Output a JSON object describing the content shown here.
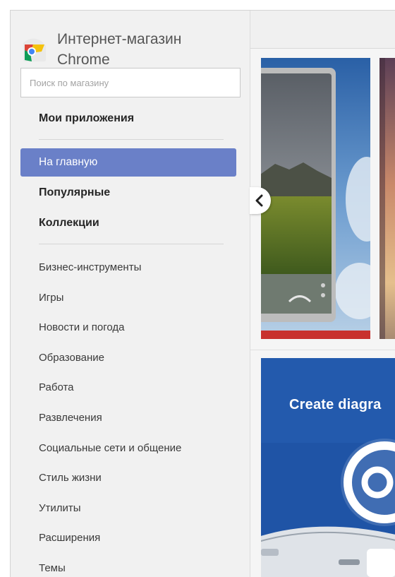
{
  "app": {
    "title_line1": "Интернет-магазин",
    "title_line2": "Chrome",
    "logo_icon": "chrome-web-store-icon"
  },
  "search": {
    "placeholder": "Поиск по магазину",
    "value": ""
  },
  "nav": {
    "my_apps": "Мои приложения",
    "home": "На главную",
    "popular": "Популярные",
    "collections": "Коллекции"
  },
  "categories": [
    "Бизнес-инструменты",
    "Игры",
    "Новости и погода",
    "Образование",
    "Работа",
    "Развлечения",
    "Социальные сети и общение",
    "Стиль жизни",
    "Утилиты",
    "Расширения",
    "Темы"
  ],
  "carousel": {
    "prev_icon": "chevron-left-icon"
  },
  "promo": {
    "text": "Create diagra"
  },
  "colors": {
    "active_nav": "#6a80c8",
    "sidebar_bg": "#f1f1f1",
    "promo_bg": "#1f54a6",
    "tile_red": "#c8312e"
  }
}
